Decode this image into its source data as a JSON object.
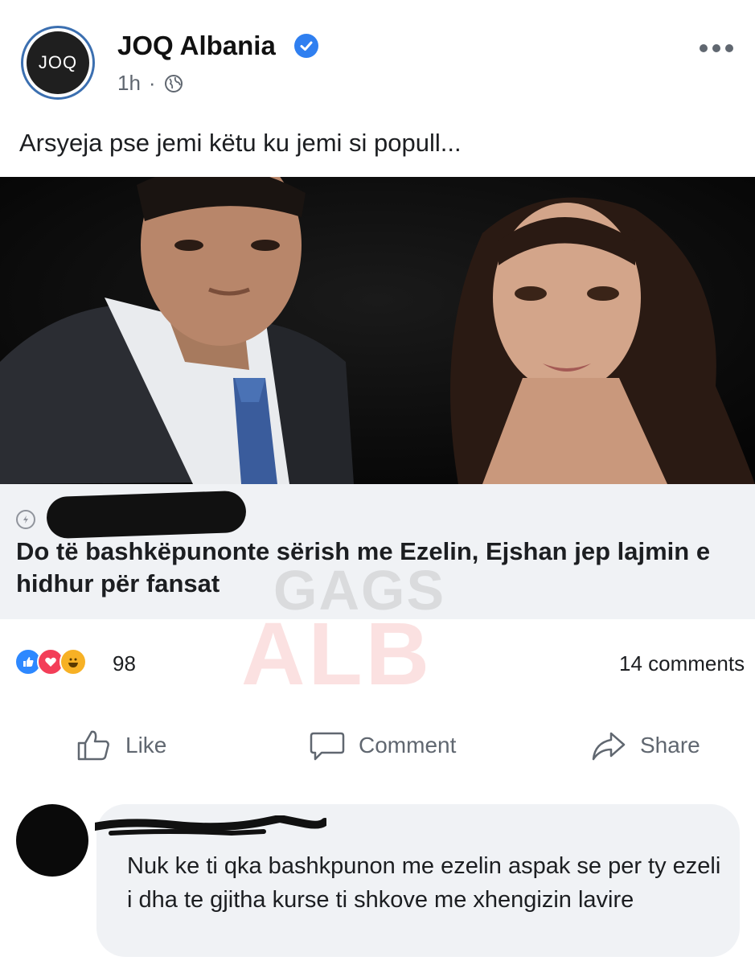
{
  "post": {
    "page_name": "JOQ Albania",
    "avatar_text": "JOQ",
    "time": "1h",
    "separator": "·",
    "text": "Arsyeja pse jemi këtu ku jemi si popull..."
  },
  "link_preview": {
    "title": "Do të bashkëpunonte sërish me Ezelin, Ejshan jep lajmin e hidhur për fansat"
  },
  "watermark": {
    "line1": "GAGS",
    "line2": "ALB"
  },
  "engagement": {
    "reactions_count": "98",
    "comments_label": "14 comments",
    "reaction_icons": [
      "like-icon",
      "love-icon",
      "haha-icon"
    ]
  },
  "actions": {
    "like": "Like",
    "comment": "Comment",
    "share": "Share"
  },
  "comment": {
    "text": "Nuk ke ti qka bashkpunon me ezelin aspak se per ty ezeli i dha te gjitha kurse ti shkove me xhengizin lavire"
  },
  "colors": {
    "verified": "#2f7ff0",
    "like_reaction": "#2d88ff",
    "love_reaction": "#f33e58",
    "haha_reaction": "#f7b125",
    "avatar_ring": "#3b6fb0"
  }
}
